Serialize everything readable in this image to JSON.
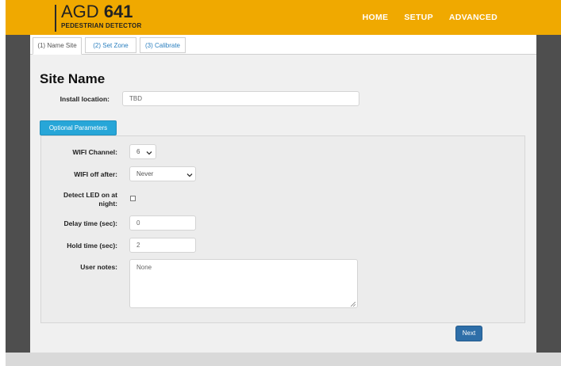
{
  "header": {
    "logo_prefix": "AGD",
    "logo_number": "641",
    "logo_subtitle": "PEDESTRIAN DETECTOR",
    "nav": [
      "HOME",
      "SETUP",
      "ADVANCED"
    ]
  },
  "tabs": [
    {
      "label": "(1) Name Site",
      "active": true
    },
    {
      "label": "(2) Set Zone",
      "active": false
    },
    {
      "label": "(3) Calibrate",
      "active": false
    }
  ],
  "page_title": "Site Name",
  "install_location": {
    "label": "Install location:",
    "value": "TBD"
  },
  "optional_button": "Optional Parameters",
  "fields": {
    "wifi_channel": {
      "label": "WIFI Channel:",
      "value": "6"
    },
    "wifi_off": {
      "label": "WIFI off after:",
      "value": "Never"
    },
    "detect_led": {
      "label_line1": "Detect LED on at",
      "label_line2": "night:",
      "checked": false
    },
    "delay_time": {
      "label": "Delay time (sec):",
      "value": "0"
    },
    "hold_time": {
      "label": "Hold time (sec):",
      "value": "2"
    },
    "user_notes": {
      "label": "User notes:",
      "value": "None"
    }
  },
  "next_button": "Next",
  "colors": {
    "header": "#f0a900",
    "optional_button": "#27a6d8",
    "next_button": "#2e6ea8",
    "sidebar": "#4e4e4e"
  }
}
